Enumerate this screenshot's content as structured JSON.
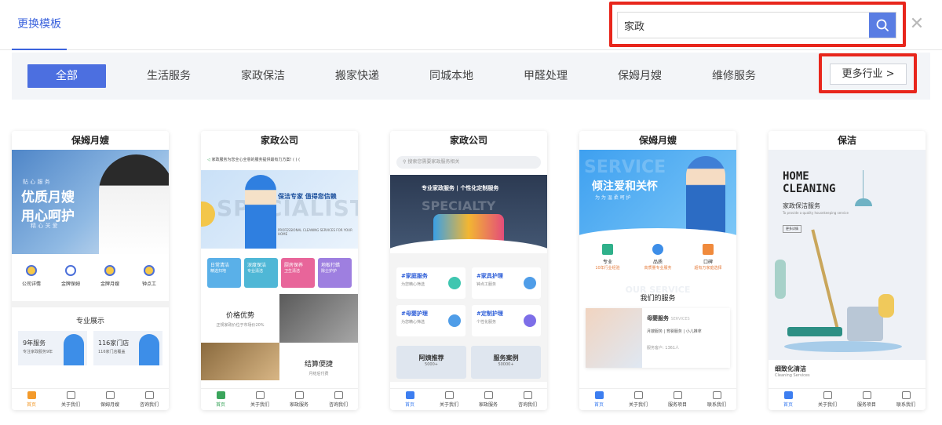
{
  "header": {
    "tab_label": "更换模板"
  },
  "search": {
    "value": "家政",
    "placeholder": ""
  },
  "categories": {
    "items": [
      "全部",
      "生活服务",
      "家政保洁",
      "搬家快递",
      "同城本地",
      "甲醛处理",
      "保姆月嫂",
      "维修服务"
    ],
    "active_index": 0,
    "more_label": "更多行业 >"
  },
  "colors": {
    "accent": "#4c6fe0",
    "highlight_box": "#e8261c"
  },
  "templates": [
    {
      "title": "保姆月嫂",
      "banner": {
        "line1": "优质月嫂",
        "line2": "用心呵护",
        "small_top": "贴 心 服 务",
        "small_bottom": "精 心 关 爱"
      },
      "icons": [
        "公司详情",
        "金牌保姆",
        "金牌月嫂",
        "钟点工"
      ],
      "section_title": "专业展示",
      "tiles": [
        {
          "title": "9年服务",
          "sub": "专注家政服务9年"
        },
        {
          "title": "116家门店",
          "sub": "116家门店覆盖"
        }
      ],
      "nav": [
        "首页",
        "关于我们",
        "保姆月嫂",
        "咨询我们"
      ]
    },
    {
      "title": "家政公司",
      "notice": "家政服务为您全心全意的服务提供最有力方案! ( ( (",
      "banner": {
        "line1": "保洁专家 值得您信赖",
        "watermark": "SPECIALIST",
        "small": "PROFESSIONAL CLEANING SERVICES FOR YOUR HOME"
      },
      "chips": [
        {
          "title": "日常清洁",
          "sub": "精选扫地"
        },
        {
          "title": "深度保洁",
          "sub": "专业清洁"
        },
        {
          "title": "厨房保养",
          "sub": "卫生清洁"
        },
        {
          "title": "地板打蜡",
          "sub": "除尘护护"
        }
      ],
      "promo1": {
        "title": "价格优势",
        "sub": "正规家政价位于市场价20%"
      },
      "promo2": {
        "title": "结算便捷",
        "sub": "月结后付费"
      },
      "nav": [
        "首页",
        "关于我们",
        "家政服务",
        "咨询我们"
      ]
    },
    {
      "title": "家政公司",
      "search_placeholder": "搜索您需要家政服务相关",
      "banner": {
        "line1": "专业家政服务 | 个性化定制服务",
        "watermark": "SPECIALTY"
      },
      "services": [
        {
          "title": "#家庭服务",
          "sub": "为您精心筛选"
        },
        {
          "title": "#家具护理",
          "sub": "钟点工服务"
        },
        {
          "title": "#母婴护理",
          "sub": "为您精心筛选"
        },
        {
          "title": "#定制护理",
          "sub": "个性化服务"
        }
      ],
      "bottom_tiles": [
        {
          "title": "阿姨推荐",
          "sub": "5000+"
        },
        {
          "title": "服务案例",
          "sub": "50000+"
        }
      ],
      "nav": [
        "首页",
        "关于我们",
        "家政服务",
        "咨询我们"
      ]
    },
    {
      "title": "保姆月嫂",
      "banner": {
        "line1": "倾注爱和关怀",
        "line2": "为 为 温 柔 呵 护",
        "watermark": "SERVICE"
      },
      "features": [
        {
          "title": "专业",
          "sub": "10年行业经验"
        },
        {
          "title": "品质",
          "sub": "高质量专业服务"
        },
        {
          "title": "口碑",
          "sub": "超有万家庭选择"
        }
      ],
      "watermark2": "OUR SERVICE",
      "section_title": "我们的服务",
      "service_card": {
        "title": "母婴服务",
        "tag": "SERVICES",
        "desc": "月嫂服务 | 育婴服务 | 小儿推拿",
        "count": "服务客户: 1361人"
      },
      "nav": [
        "首页",
        "关于我们",
        "服务项目",
        "联系我们"
      ]
    },
    {
      "title": "保洁",
      "banner": {
        "line1": "HOME",
        "line2": "CLEANING",
        "sub": "家政保洁服务",
        "tiny": "To provide a quality housekeeping service",
        "btn": "更多详情"
      },
      "footer_title": "细致化清洁",
      "footer_sub": "Cleaning Services",
      "nav": [
        "首页",
        "关于我们",
        "服务项目",
        "联系我们"
      ]
    }
  ]
}
